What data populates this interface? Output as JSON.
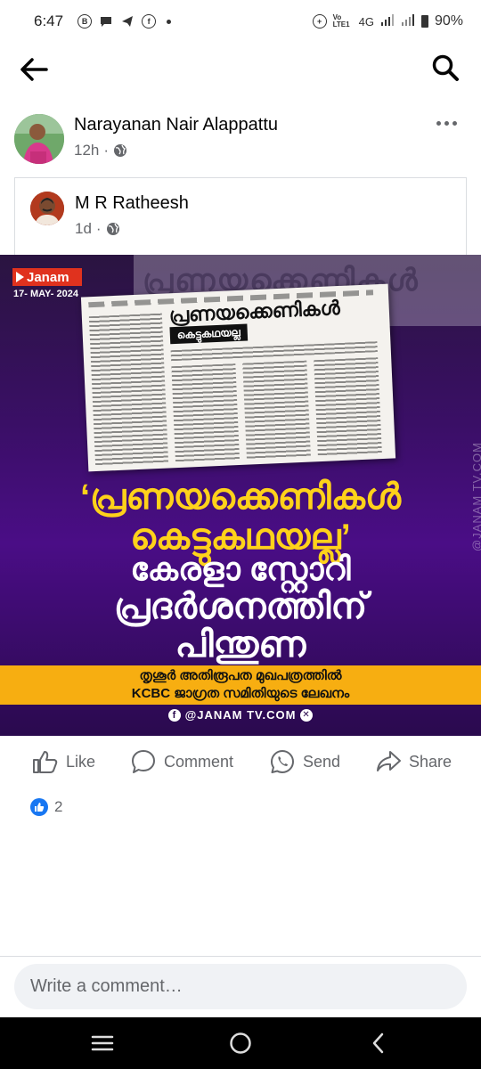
{
  "status_bar": {
    "time": "6:47",
    "left_icons": [
      "b-circle-icon",
      "chat-bubble-icon",
      "telegram-icon",
      "facebook-icon"
    ],
    "network": "4G",
    "lte_label": "Vo LTE1",
    "battery": "90%"
  },
  "post": {
    "author": "Narayanan Nair Alappattu",
    "time": "12h",
    "privacy": "public"
  },
  "shared_post": {
    "author": "M R Ratheesh",
    "time": "1d",
    "privacy": "public",
    "image": {
      "channel": "Janam",
      "date": "17- MAY- 2024",
      "clipping_headline": "പ്രണയക്കെണികൾ",
      "clipping_subheadline": "കെട്ടുകഥയല്ല",
      "headline_lines": [
        "‘പ്രണയക്കെണികൾ",
        "കെട്ടുകഥയല്ല’",
        "കേരളാ സ്റ്റോറി",
        "പ്രദർശനത്തിന്",
        "പിന്തുണ"
      ],
      "band_line_1": "തൃശൂർ അതിരൂപത മുഖപത്രത്തിൽ",
      "band_line_2": "KCBC ജാഗ്രത സമിതിയുടെ ലേഖനം",
      "watermark_bottom": "@JANAM TV.COM",
      "watermark_side": "@JANAM TV.COM",
      "accent_yellow": "#ffd21a",
      "band_color": "#f7ae11"
    }
  },
  "actions": {
    "like": "Like",
    "comment": "Comment",
    "send": "Send",
    "share": "Share"
  },
  "reactions": {
    "count": "2"
  },
  "comment_box": {
    "placeholder": "Write a comment…"
  },
  "colors": {
    "brand_blue": "#1877f2",
    "muted_text": "#65676b"
  }
}
